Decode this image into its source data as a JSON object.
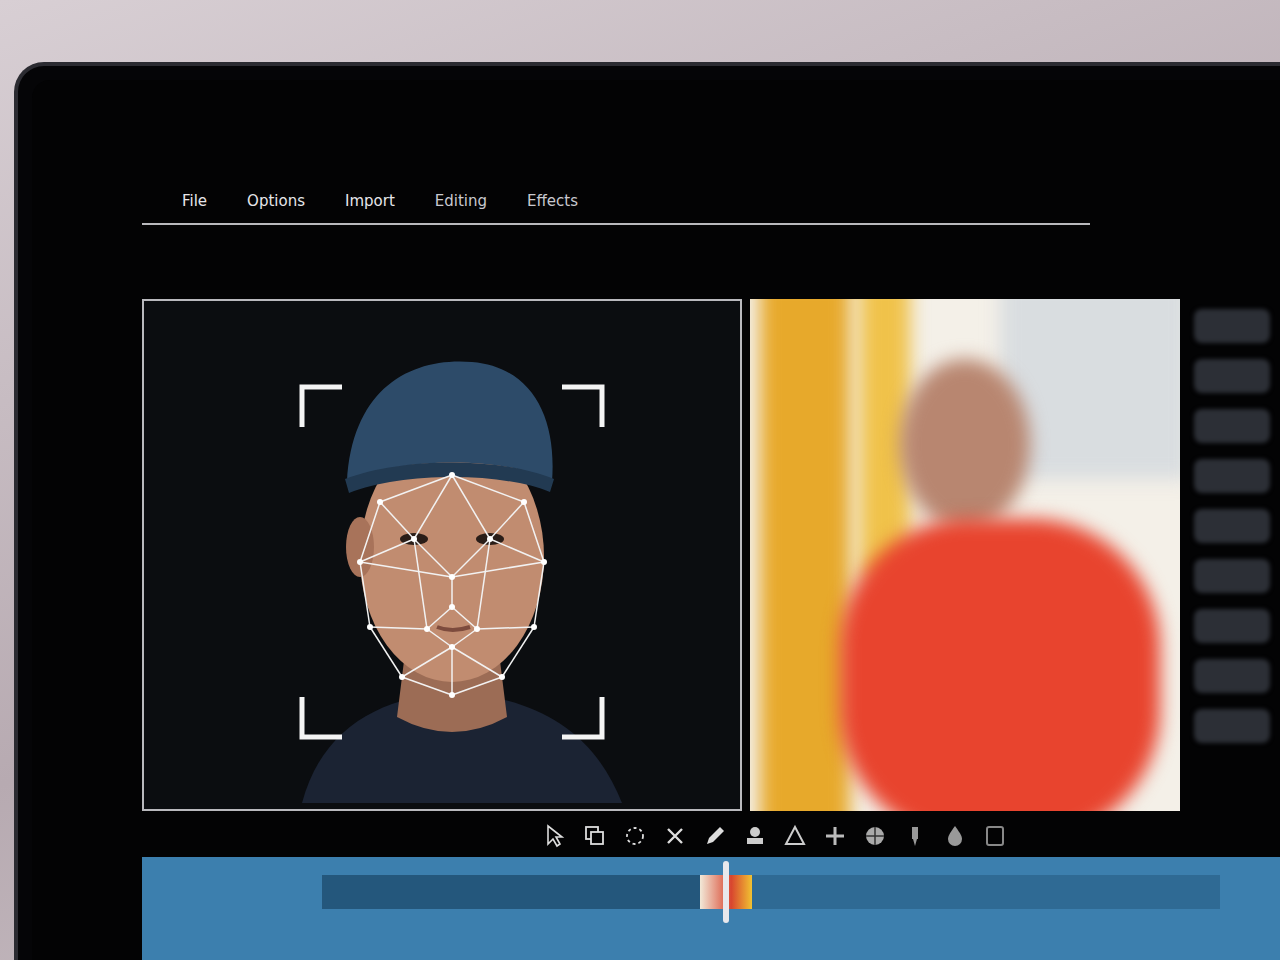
{
  "menu": [
    "File",
    "Options",
    "Import",
    "Editing",
    "Effects"
  ],
  "face_detection": {
    "detected": true
  },
  "timeline": {
    "level": 0.45
  }
}
